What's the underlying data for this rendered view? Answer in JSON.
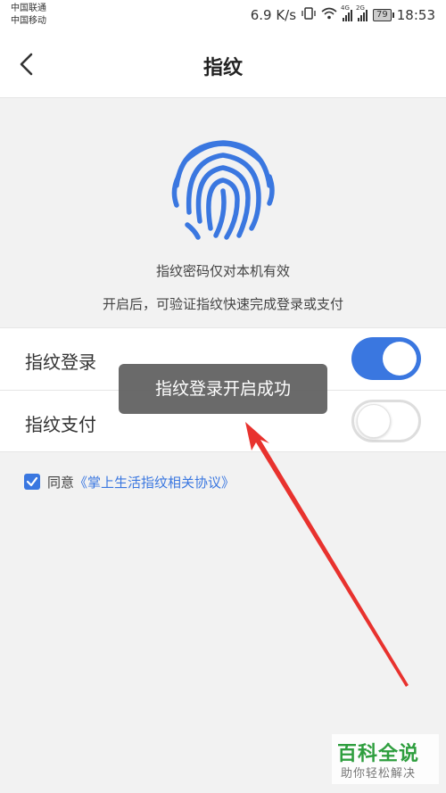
{
  "status_bar": {
    "carrier1": "中国联通",
    "carrier2": "中国移动",
    "speed": "6.9 K/s",
    "sig1_tag": "4G",
    "sig2_tag": "2G",
    "battery": "79",
    "time": "18:53"
  },
  "navbar": {
    "title": "指纹"
  },
  "main": {
    "hint1": "指纹密码仅对本机有效",
    "hint2": "开启后，可验证指纹快速完成登录或支付"
  },
  "settings": [
    {
      "label": "指纹登录",
      "enabled": true
    },
    {
      "label": "指纹支付",
      "enabled": false
    }
  ],
  "agreement": {
    "checked": true,
    "text": "同意",
    "link": "《掌上生活指纹相关协议》"
  },
  "toast": "指纹登录开启成功",
  "watermark": {
    "title": "百科全说",
    "subtitle": "助你轻松解决"
  },
  "colors": {
    "accent": "#3a77e0",
    "arrow": "#e8322e",
    "watermark": "#2e9e3e"
  }
}
